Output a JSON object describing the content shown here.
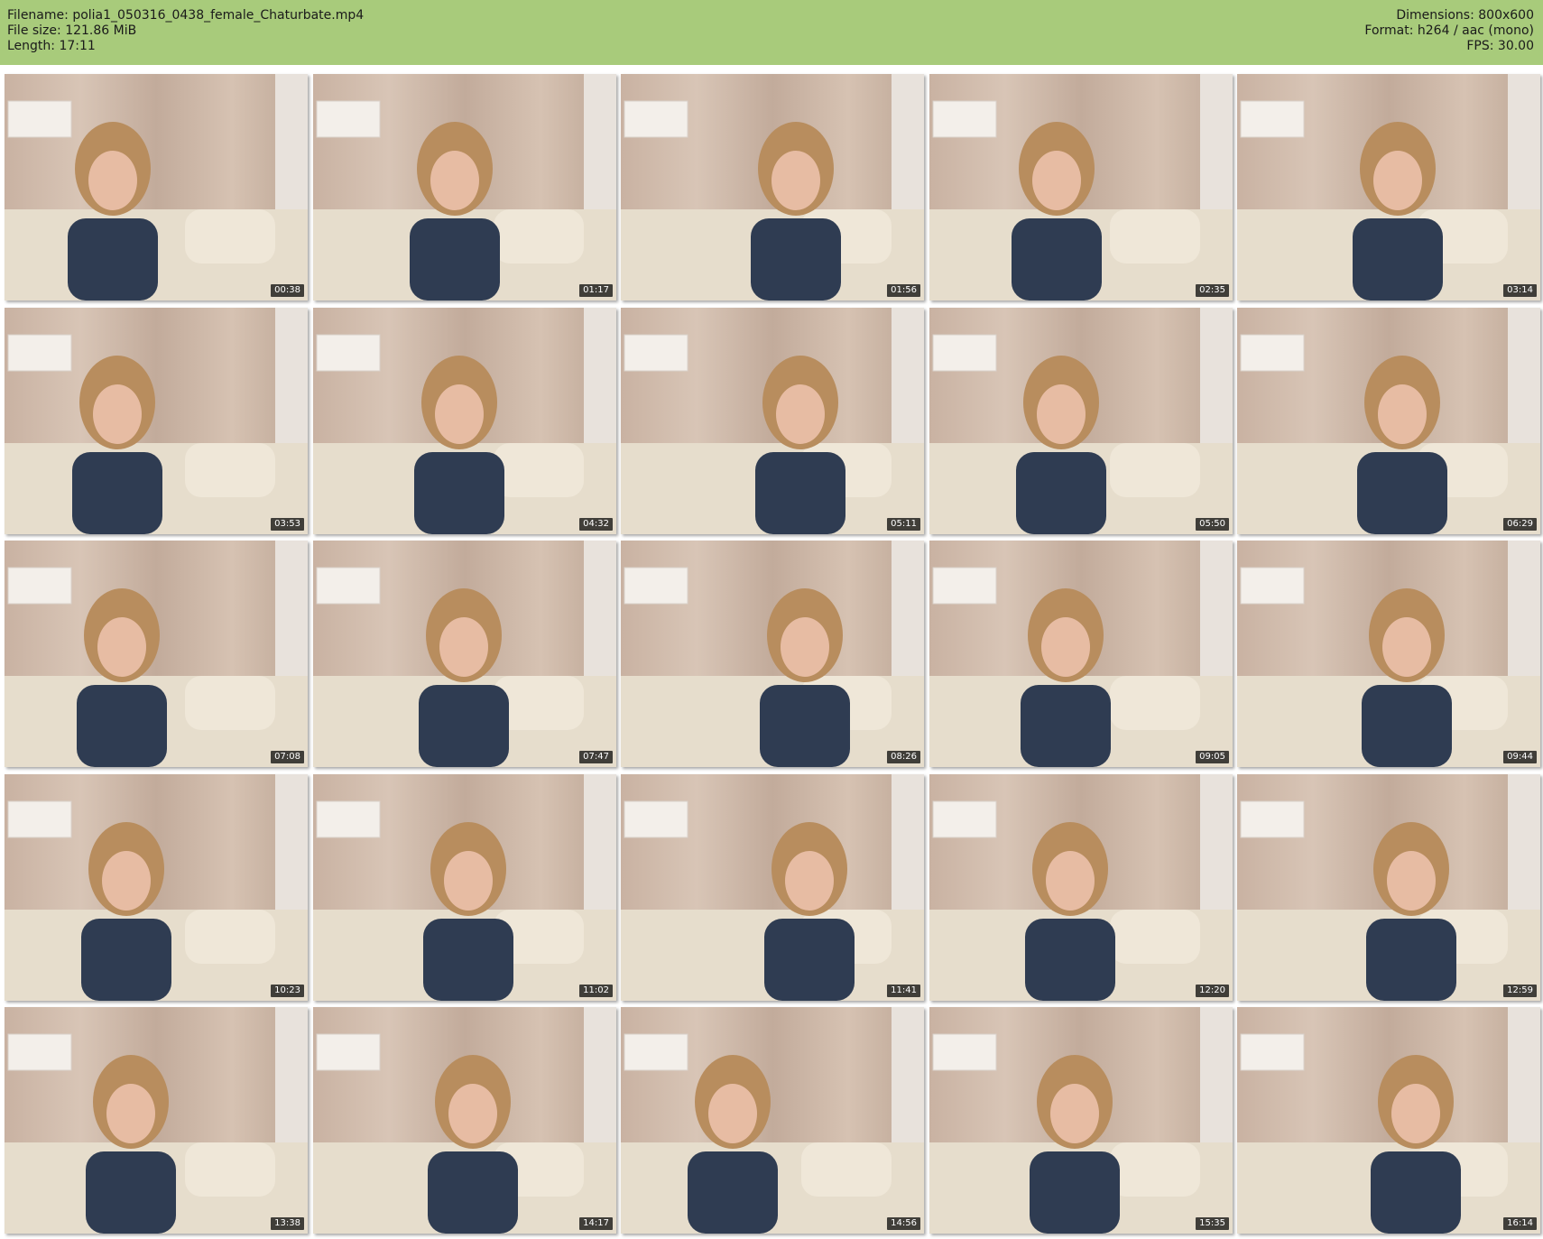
{
  "header": {
    "filename_label": "Filename:",
    "filename": "polia1_050316_0438_female_Chaturbate.mp4",
    "filesize_label": "File size:",
    "filesize": "121.86 MiB",
    "length_label": "Length:",
    "length": "17:11",
    "dimensions_label": "Dimensions:",
    "dimensions": "800x600",
    "format_label": "Format:",
    "format": "h264 / aac (mono)",
    "fps_label": "FPS:",
    "fps": "30.00"
  },
  "colors": {
    "header_bg": "#a8cb7b",
    "page_bg": "#ffffff",
    "timestamp_bg": "#000000"
  },
  "thumbnails": [
    {
      "time": "00:38"
    },
    {
      "time": "01:17"
    },
    {
      "time": "01:56"
    },
    {
      "time": "02:35"
    },
    {
      "time": "03:14"
    },
    {
      "time": "03:53"
    },
    {
      "time": "04:32"
    },
    {
      "time": "05:11"
    },
    {
      "time": "05:50"
    },
    {
      "time": "06:29"
    },
    {
      "time": "07:08"
    },
    {
      "time": "07:47"
    },
    {
      "time": "08:26"
    },
    {
      "time": "09:05"
    },
    {
      "time": "09:44"
    },
    {
      "time": "10:23"
    },
    {
      "time": "11:02"
    },
    {
      "time": "11:41"
    },
    {
      "time": "12:20"
    },
    {
      "time": "12:59"
    },
    {
      "time": "13:38"
    },
    {
      "time": "14:17"
    },
    {
      "time": "14:56"
    },
    {
      "time": "15:35"
    },
    {
      "time": "16:14"
    }
  ]
}
